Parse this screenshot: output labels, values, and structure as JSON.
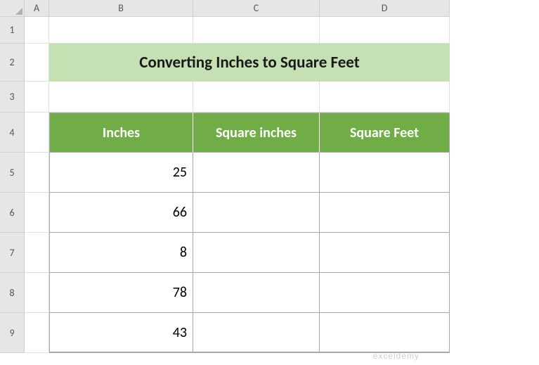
{
  "columns": [
    "A",
    "B",
    "C",
    "D"
  ],
  "rows": [
    "1",
    "2",
    "3",
    "4",
    "5",
    "6",
    "7",
    "8",
    "9"
  ],
  "title": "Converting Inches to Square Feet",
  "headers": {
    "inches": "Inches",
    "sqin": "Square inches",
    "sqft": "Square Feet"
  },
  "chart_data": {
    "type": "table",
    "columns": [
      "Inches",
      "Square inches",
      "Square Feet"
    ],
    "rows": [
      {
        "inches": 25,
        "sqin": "",
        "sqft": ""
      },
      {
        "inches": 66,
        "sqin": "",
        "sqft": ""
      },
      {
        "inches": 8,
        "sqin": "",
        "sqft": ""
      },
      {
        "inches": 78,
        "sqin": "",
        "sqft": ""
      },
      {
        "inches": 43,
        "sqin": "",
        "sqft": ""
      }
    ]
  },
  "watermark": "exceldemy"
}
